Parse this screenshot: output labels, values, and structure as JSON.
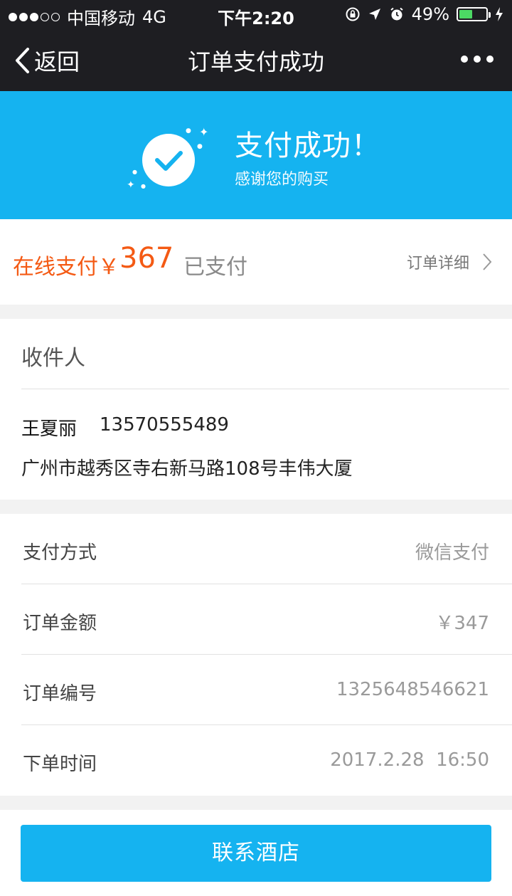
{
  "status_bar": {
    "carrier": "中国移动",
    "network": "4G",
    "time": "下午2:20",
    "battery": "49%",
    "battery_level": 0.49
  },
  "nav": {
    "back_label": "返回",
    "title": "订单支付成功"
  },
  "banner": {
    "title": "支付成功！",
    "subtitle": "感谢您的购买"
  },
  "payment": {
    "label": "在线支付￥",
    "amount": "367",
    "status": "已支付",
    "detail_link": "订单详细"
  },
  "receiver": {
    "heading": "收件人",
    "name": "王夏丽",
    "phone": "13570555489",
    "address": "广州市越秀区寺右新马路108号丰伟大厦"
  },
  "order_info": [
    {
      "label": "支付方式",
      "value": "微信支付"
    },
    {
      "label": "订单金额",
      "value": "￥347"
    },
    {
      "label": "订单编号",
      "value": "1325648546621"
    },
    {
      "label": "下单时间",
      "value": "2017.2.28  16:50"
    }
  ],
  "actions": {
    "contact_label": "联系酒店"
  },
  "colors": {
    "accent_blue": "#15b3f0",
    "price_orange": "#f45a14",
    "dark_bar": "#1e1e22"
  }
}
